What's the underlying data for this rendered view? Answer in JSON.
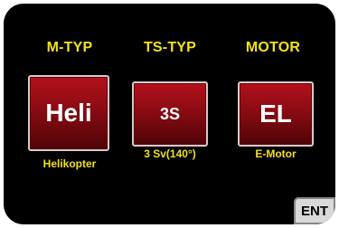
{
  "columns": [
    {
      "header": "M-TYP",
      "value": "Heli",
      "caption": "Helikopter"
    },
    {
      "header": "TS-TYP",
      "value": "3S",
      "caption": "3 Sv(140°)"
    },
    {
      "header": "MOTOR",
      "value": "EL",
      "caption": "E-Motor"
    }
  ],
  "footer": {
    "ent_label": "ENT"
  },
  "colors": {
    "background": "#000000",
    "label_yellow": "#f2e11a",
    "tile_red": "#8a0b13",
    "ent_button": "#d9d9d9"
  }
}
